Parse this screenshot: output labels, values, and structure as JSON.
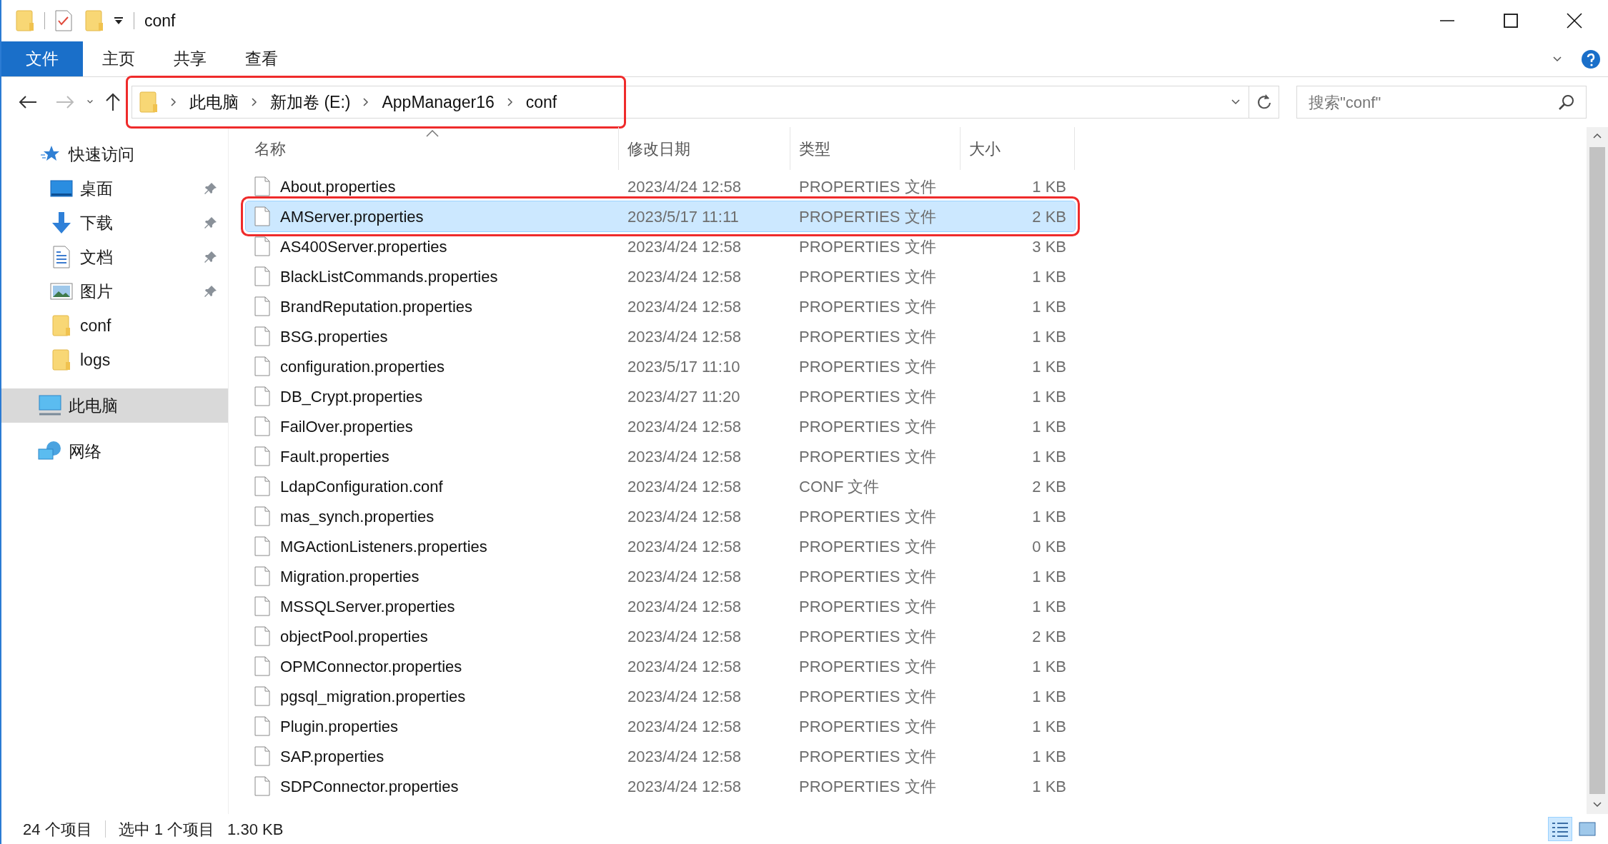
{
  "window": {
    "title": "conf"
  },
  "ribbon_tabs": [
    {
      "label": "文件",
      "kind": "file"
    },
    {
      "label": "主页",
      "kind": "tab"
    },
    {
      "label": "共享",
      "kind": "tab"
    },
    {
      "label": "查看",
      "kind": "tab"
    }
  ],
  "address_bar": {
    "annotated": true,
    "path": [
      "此电脑",
      "新加卷 (E:)",
      "AppManager16",
      "conf"
    ]
  },
  "search": {
    "placeholder": "搜索\"conf\""
  },
  "sidebar": {
    "items": [
      {
        "label": "快速访问",
        "kind": "quick",
        "selected": false,
        "children": [
          {
            "label": "桌面",
            "kind": "desktop",
            "pinned": true,
            "selected": false
          },
          {
            "label": "下载",
            "kind": "download",
            "pinned": true,
            "selected": false
          },
          {
            "label": "文档",
            "kind": "document",
            "pinned": true,
            "selected": false
          },
          {
            "label": "图片",
            "kind": "picture",
            "pinned": true,
            "selected": false
          },
          {
            "label": "conf",
            "kind": "folder",
            "pinned": false,
            "selected": false
          },
          {
            "label": "logs",
            "kind": "folder",
            "pinned": false,
            "selected": false
          }
        ]
      },
      {
        "label": "此电脑",
        "kind": "pc",
        "selected": true
      },
      {
        "label": "网络",
        "kind": "network",
        "selected": false
      }
    ]
  },
  "table": {
    "columns": [
      "名称",
      "修改日期",
      "类型",
      "大小"
    ],
    "rows": [
      {
        "name": "About.properties",
        "date": "2023/4/24 12:58",
        "type": "PROPERTIES 文件",
        "size": "1 KB",
        "selected": false,
        "annotated": false
      },
      {
        "name": "AMServer.properties",
        "date": "2023/5/17 11:11",
        "type": "PROPERTIES 文件",
        "size": "2 KB",
        "selected": true,
        "annotated": true
      },
      {
        "name": "AS400Server.properties",
        "date": "2023/4/24 12:58",
        "type": "PROPERTIES 文件",
        "size": "3 KB",
        "selected": false,
        "annotated": false
      },
      {
        "name": "BlackListCommands.properties",
        "date": "2023/4/24 12:58",
        "type": "PROPERTIES 文件",
        "size": "1 KB",
        "selected": false,
        "annotated": false
      },
      {
        "name": "BrandReputation.properties",
        "date": "2023/4/24 12:58",
        "type": "PROPERTIES 文件",
        "size": "1 KB",
        "selected": false,
        "annotated": false
      },
      {
        "name": "BSG.properties",
        "date": "2023/4/24 12:58",
        "type": "PROPERTIES 文件",
        "size": "1 KB",
        "selected": false,
        "annotated": false
      },
      {
        "name": "configuration.properties",
        "date": "2023/5/17 11:10",
        "type": "PROPERTIES 文件",
        "size": "1 KB",
        "selected": false,
        "annotated": false
      },
      {
        "name": "DB_Crypt.properties",
        "date": "2023/4/27 11:20",
        "type": "PROPERTIES 文件",
        "size": "1 KB",
        "selected": false,
        "annotated": false
      },
      {
        "name": "FailOver.properties",
        "date": "2023/4/24 12:58",
        "type": "PROPERTIES 文件",
        "size": "1 KB",
        "selected": false,
        "annotated": false
      },
      {
        "name": "Fault.properties",
        "date": "2023/4/24 12:58",
        "type": "PROPERTIES 文件",
        "size": "1 KB",
        "selected": false,
        "annotated": false
      },
      {
        "name": "LdapConfiguration.conf",
        "date": "2023/4/24 12:58",
        "type": "CONF 文件",
        "size": "2 KB",
        "selected": false,
        "annotated": false
      },
      {
        "name": "mas_synch.properties",
        "date": "2023/4/24 12:58",
        "type": "PROPERTIES 文件",
        "size": "1 KB",
        "selected": false,
        "annotated": false
      },
      {
        "name": "MGActionListeners.properties",
        "date": "2023/4/24 12:58",
        "type": "PROPERTIES 文件",
        "size": "0 KB",
        "selected": false,
        "annotated": false
      },
      {
        "name": "Migration.properties",
        "date": "2023/4/24 12:58",
        "type": "PROPERTIES 文件",
        "size": "1 KB",
        "selected": false,
        "annotated": false
      },
      {
        "name": "MSSQLServer.properties",
        "date": "2023/4/24 12:58",
        "type": "PROPERTIES 文件",
        "size": "1 KB",
        "selected": false,
        "annotated": false
      },
      {
        "name": "objectPool.properties",
        "date": "2023/4/24 12:58",
        "type": "PROPERTIES 文件",
        "size": "2 KB",
        "selected": false,
        "annotated": false
      },
      {
        "name": "OPMConnector.properties",
        "date": "2023/4/24 12:58",
        "type": "PROPERTIES 文件",
        "size": "1 KB",
        "selected": false,
        "annotated": false
      },
      {
        "name": "pgsql_migration.properties",
        "date": "2023/4/24 12:58",
        "type": "PROPERTIES 文件",
        "size": "1 KB",
        "selected": false,
        "annotated": false
      },
      {
        "name": "Plugin.properties",
        "date": "2023/4/24 12:58",
        "type": "PROPERTIES 文件",
        "size": "1 KB",
        "selected": false,
        "annotated": false
      },
      {
        "name": "SAP.properties",
        "date": "2023/4/24 12:58",
        "type": "PROPERTIES 文件",
        "size": "1 KB",
        "selected": false,
        "annotated": false
      },
      {
        "name": "SDPConnector.properties",
        "date": "2023/4/24 12:58",
        "type": "PROPERTIES 文件",
        "size": "1 KB",
        "selected": false,
        "annotated": false
      }
    ]
  },
  "status_bar": {
    "count": "24 个项目",
    "selection": "选中 1 个项目",
    "size": "1.30 KB"
  },
  "view_buttons": [
    {
      "kind": "details",
      "selected": true
    },
    {
      "kind": "large",
      "selected": false
    }
  ]
}
